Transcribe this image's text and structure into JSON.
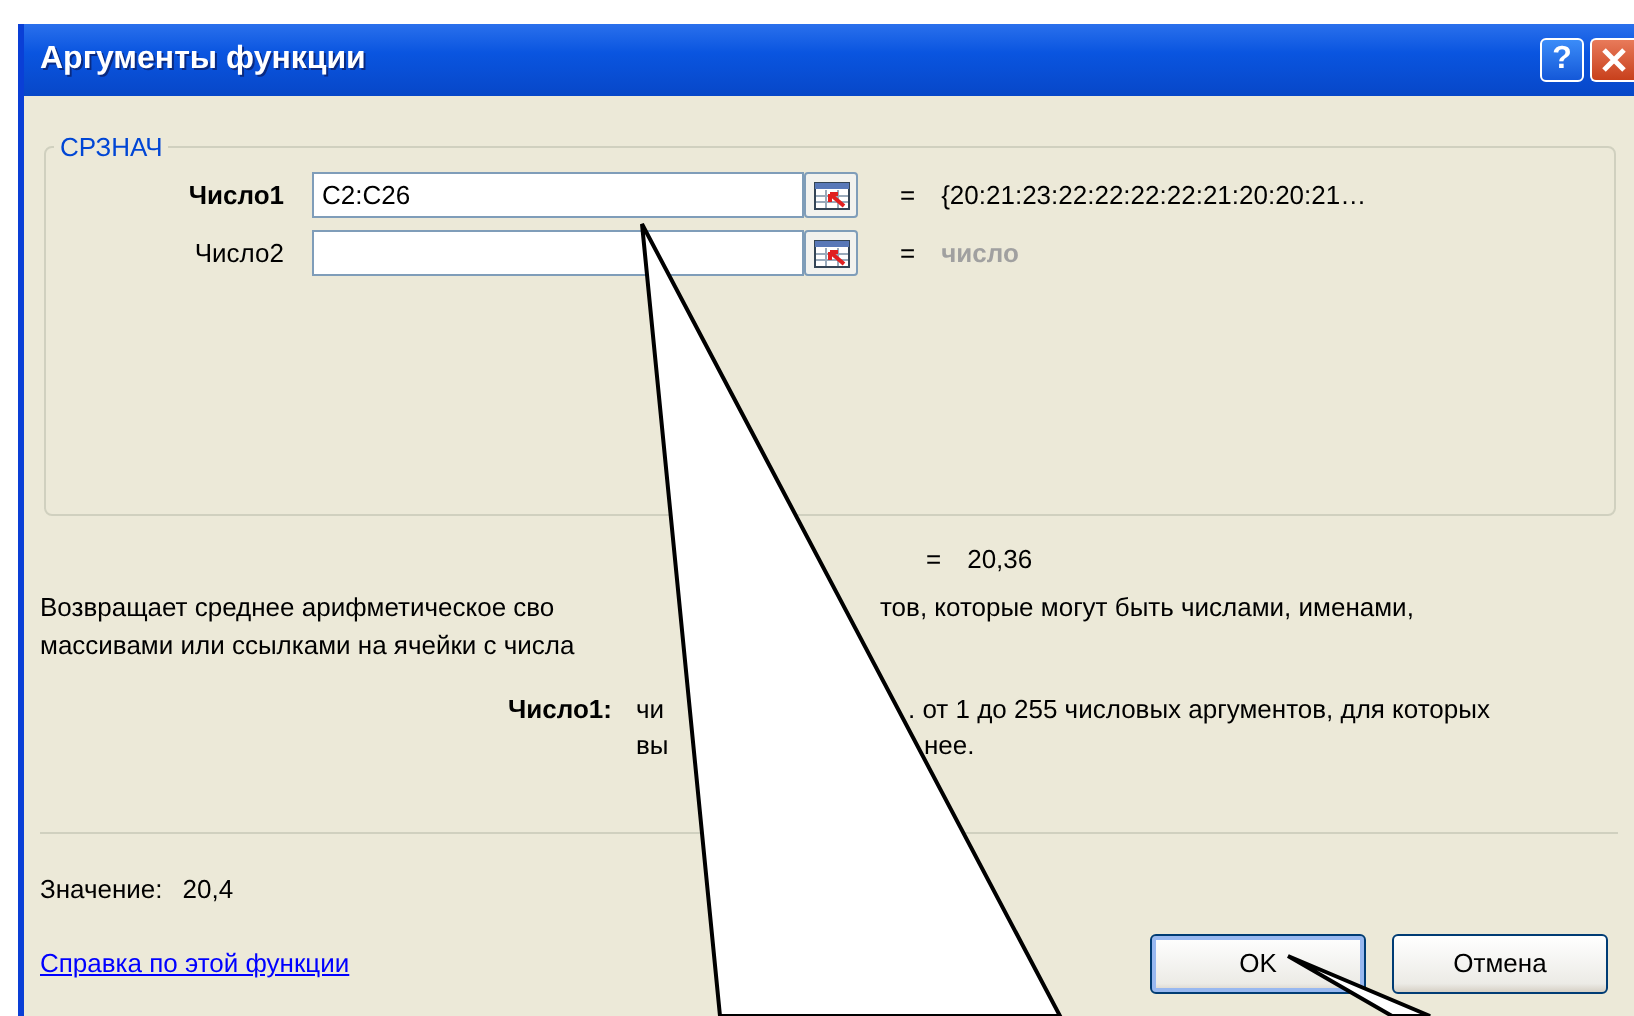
{
  "window": {
    "title": "Аргументы функции",
    "help": "?"
  },
  "function_group": {
    "name": "СРЗНАЧ",
    "arguments": [
      {
        "label": "Число1",
        "selected": true,
        "value": "C2:C26",
        "sign": "=",
        "result": "{20:21:23:22:22:22:22:21:20:20:21…",
        "greyed": false
      },
      {
        "label": "Число2",
        "selected": false,
        "sign": "=",
        "result": "число",
        "greyed": true
      }
    ]
  },
  "formula_result": {
    "sign": "=",
    "value": "20,36"
  },
  "description": [
    {
      "left": "Возвращает среднее арифметическое сво",
      "right": "тов, которые могут быть числами, именами,"
    },
    {
      "left": "массивами или ссылками на ячейки с числа"
    }
  ],
  "argument_help": {
    "label": "Число1:",
    "lines": [
      {
        "left": "чи",
        "right": ". от 1 до 255 числовых аргументов, для которых"
      },
      {
        "left": "вы",
        "right": "нее."
      }
    ]
  },
  "value": {
    "label": "Значение:",
    "text": "20,4"
  },
  "help_link": "Справка по этой функции",
  "buttons": [
    {
      "label": "OK",
      "kind": "default"
    },
    {
      "label": "Отмена",
      "kind": "normal"
    }
  ]
}
